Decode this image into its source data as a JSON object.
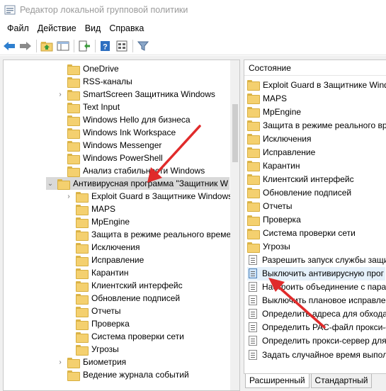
{
  "window": {
    "title": "Редактор локальной групповой политики"
  },
  "menu": [
    "Файл",
    "Действие",
    "Вид",
    "Справка"
  ],
  "toolbar": [
    "back-icon",
    "forward-icon",
    "up-folder-icon",
    "show-tree-icon",
    "export-icon",
    "help-icon",
    "properties-icon",
    "filter-icon"
  ],
  "tree": [
    {
      "label": "OneDrive",
      "expander": ""
    },
    {
      "label": "RSS-каналы",
      "expander": ""
    },
    {
      "label": "SmartScreen Защитника Windows",
      "expander": "›"
    },
    {
      "label": "Text Input",
      "expander": ""
    },
    {
      "label": "Windows Hello для бизнеса",
      "expander": ""
    },
    {
      "label": "Windows Ink Workspace",
      "expander": ""
    },
    {
      "label": "Windows Messenger",
      "expander": ""
    },
    {
      "label": "Windows PowerShell",
      "expander": ""
    },
    {
      "label": "Анализ стабильности Windows",
      "expander": ""
    },
    {
      "label": "Антивирусная программа \"Защитник W",
      "expander": "⌄",
      "selected": true
    },
    {
      "label": "Exploit Guard в Защитнике Windows",
      "expander": "›"
    },
    {
      "label": "MAPS",
      "expander": ""
    },
    {
      "label": "MpEngine",
      "expander": ""
    },
    {
      "label": "Защита в режиме реального времен",
      "expander": ""
    },
    {
      "label": "Исключения",
      "expander": ""
    },
    {
      "label": "Исправление",
      "expander": ""
    },
    {
      "label": "Карантин",
      "expander": ""
    },
    {
      "label": "Клиентский интерфейс",
      "expander": ""
    },
    {
      "label": "Обновление подписей",
      "expander": ""
    },
    {
      "label": "Отчеты",
      "expander": ""
    },
    {
      "label": "Проверка",
      "expander": ""
    },
    {
      "label": "Система проверки сети",
      "expander": ""
    },
    {
      "label": "Угрозы",
      "expander": ""
    },
    {
      "label": "Биометрия",
      "expander": "›"
    },
    {
      "label": "Ведение журнала событий",
      "expander": ""
    }
  ],
  "right": {
    "column_header": "Состояние",
    "items": [
      {
        "label": "Exploit Guard в Защитнике Windo",
        "icon": "folder"
      },
      {
        "label": "MAPS",
        "icon": "folder"
      },
      {
        "label": "MpEngine",
        "icon": "folder"
      },
      {
        "label": "Защита в режиме реального вре",
        "icon": "folder"
      },
      {
        "label": "Исключения",
        "icon": "folder"
      },
      {
        "label": "Исправление",
        "icon": "folder"
      },
      {
        "label": "Карантин",
        "icon": "folder"
      },
      {
        "label": "Клиентский интерфейс",
        "icon": "folder"
      },
      {
        "label": "Обновление подписей",
        "icon": "folder"
      },
      {
        "label": "Отчеты",
        "icon": "folder"
      },
      {
        "label": "Проверка",
        "icon": "folder"
      },
      {
        "label": "Система проверки сети",
        "icon": "folder"
      },
      {
        "label": "Угрозы",
        "icon": "folder"
      },
      {
        "label": "Разрешить запуск службы защи",
        "icon": "setting"
      },
      {
        "label": "Выключить антивирусную прог",
        "icon": "setting",
        "selected": true
      },
      {
        "label": "Настроить объединение с парам",
        "icon": "setting"
      },
      {
        "label": "Выключить плановое исправлен",
        "icon": "setting"
      },
      {
        "label": "Определить адреса для обхода п",
        "icon": "setting"
      },
      {
        "label": "Определить PAC-файл прокси-се",
        "icon": "setting"
      },
      {
        "label": "Определить прокси-сервер для",
        "icon": "setting"
      },
      {
        "label": "Задать случайное время выпол",
        "icon": "setting"
      }
    ]
  },
  "tabs": [
    {
      "label": "Расширенный",
      "active": true
    },
    {
      "label": "Стандартный",
      "active": false
    }
  ],
  "colors": {
    "annotation_arrow": "#e02b2b",
    "folder": "#f4d06f",
    "selection": "#d9d9d9"
  }
}
